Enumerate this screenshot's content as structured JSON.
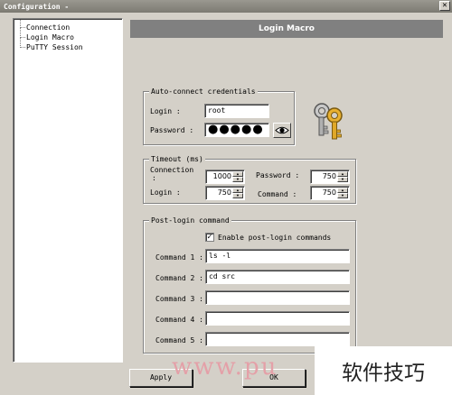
{
  "window": {
    "title": "Configuration -",
    "close_glyph": "✕"
  },
  "tree": {
    "items": [
      "Connection",
      "Login Macro",
      "PuTTY Session"
    ]
  },
  "header": {
    "title": "Login Macro"
  },
  "credentials": {
    "legend": "Auto-connect credentials",
    "login_label": "Login :",
    "login_value": "root",
    "password_label": "Password :",
    "password_value": "●●●●●"
  },
  "timeout": {
    "legend": "Timeout (ms)",
    "connection_label": "Connection",
    "connection_colon": ":",
    "connection_value": "1000",
    "login_label": "Login :",
    "login_value": "750",
    "password_label": "Password :",
    "password_value": "750",
    "command_label": "Command :",
    "command_value": "750"
  },
  "post_login": {
    "legend": "Post-login command",
    "enable_label": "Enable post-login commands",
    "enable_checked": true,
    "commands": [
      {
        "label": "Command 1 :",
        "value": "ls -l"
      },
      {
        "label": "Command 2 :",
        "value": "cd src"
      },
      {
        "label": "Command 3 :",
        "value": ""
      },
      {
        "label": "Command 4 :",
        "value": ""
      },
      {
        "label": "Command 5 :",
        "value": ""
      }
    ]
  },
  "buttons": {
    "apply": "Apply",
    "ok": "OK"
  },
  "watermark": {
    "latin": "www.pu",
    "cn": "软件技巧"
  },
  "colors": {
    "header_bg": "#808080",
    "dialog_bg": "#d4d0c8",
    "watermark": "#e4a0a8"
  }
}
